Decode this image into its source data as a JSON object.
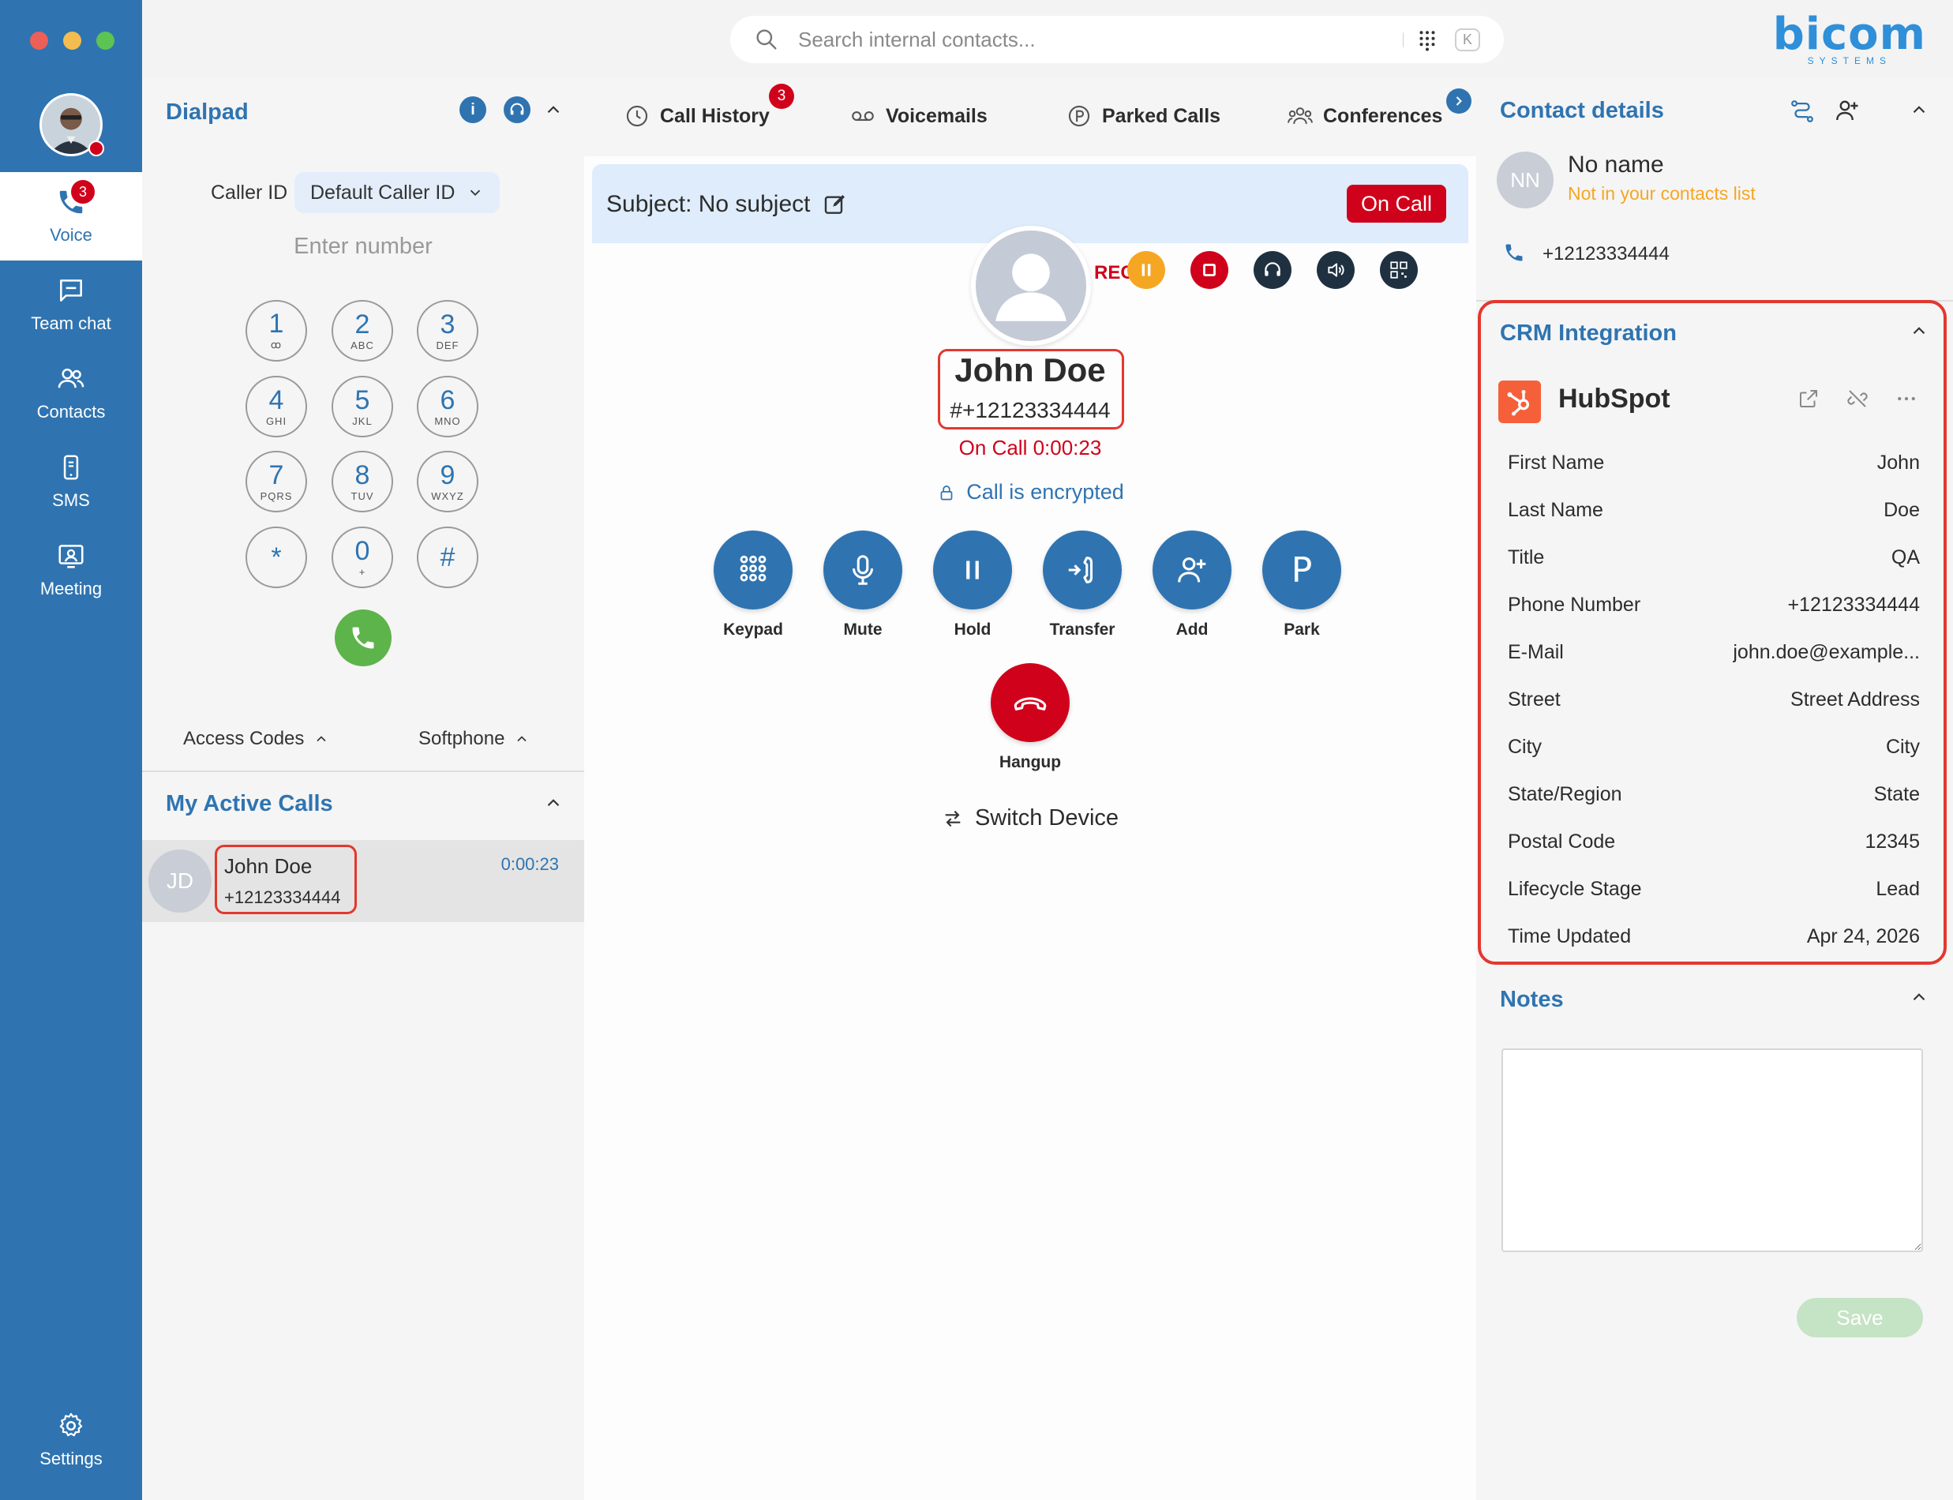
{
  "nav": {
    "items": [
      {
        "label": "Voice",
        "badge": "3"
      },
      {
        "label": "Team chat"
      },
      {
        "label": "Contacts"
      },
      {
        "label": "SMS"
      },
      {
        "label": "Meeting"
      }
    ],
    "settings_label": "Settings"
  },
  "topbar": {
    "search_placeholder": "Search internal contacts...",
    "shortcut_key1": "⌘",
    "shortcut_plus": "+",
    "shortcut_key2": "K",
    "logo_text": "bicom",
    "logo_sub": "SYSTEMS"
  },
  "dialpad": {
    "title": "Dialpad",
    "info_glyph": "i",
    "caller_id_label": "Caller ID",
    "caller_id_value": "Default Caller ID",
    "enter_number_placeholder": "Enter number",
    "keys": [
      {
        "digit": "1",
        "letters": "ꝏ"
      },
      {
        "digit": "2",
        "letters": "ABC"
      },
      {
        "digit": "3",
        "letters": "DEF"
      },
      {
        "digit": "4",
        "letters": "GHI"
      },
      {
        "digit": "5",
        "letters": "JKL"
      },
      {
        "digit": "6",
        "letters": "MNO"
      },
      {
        "digit": "7",
        "letters": "PQRS"
      },
      {
        "digit": "8",
        "letters": "TUV"
      },
      {
        "digit": "9",
        "letters": "WXYZ"
      },
      {
        "digit": "*",
        "letters": ""
      },
      {
        "digit": "0",
        "letters": "+"
      },
      {
        "digit": "#",
        "letters": ""
      }
    ],
    "access_codes_label": "Access Codes",
    "softphone_label": "Softphone"
  },
  "active_calls": {
    "title": "My Active Calls",
    "calls": [
      {
        "initials": "JD",
        "name": "John Doe",
        "number": "+12123334444",
        "duration": "0:00:23"
      }
    ]
  },
  "tabs": [
    {
      "label": "Call History",
      "badge": "3"
    },
    {
      "label": "Voicemails"
    },
    {
      "label": "Parked Calls"
    },
    {
      "label": "Conferences"
    }
  ],
  "call": {
    "subject": "Subject: No subject",
    "status_pill": "On Call",
    "rec_label": "REC",
    "caller_name": "John Doe",
    "caller_number": "#+12123334444",
    "status_time": "On Call 0:00:23",
    "encrypted_label": "Call is encrypted",
    "actions": [
      {
        "label": "Keypad"
      },
      {
        "label": "Mute"
      },
      {
        "label": "Hold"
      },
      {
        "label": "Transfer"
      },
      {
        "label": "Add"
      },
      {
        "label": "Park",
        "glyph": "P"
      }
    ],
    "hangup_label": "Hangup",
    "switch_device_label": "Switch Device"
  },
  "contact": {
    "title": "Contact details",
    "initials": "NN",
    "name": "No name",
    "subtitle": "Not in your contacts list",
    "phone": "+12123334444"
  },
  "crm": {
    "title": "CRM Integration",
    "provider": "HubSpot",
    "fields": [
      {
        "label": "First Name",
        "value": "John"
      },
      {
        "label": "Last Name",
        "value": "Doe"
      },
      {
        "label": "Title",
        "value": "QA"
      },
      {
        "label": "Phone Number",
        "value": "+12123334444"
      },
      {
        "label": "E-Mail",
        "value": "john.doe@example..."
      },
      {
        "label": "Street",
        "value": "Street Address"
      },
      {
        "label": "City",
        "value": "City"
      },
      {
        "label": "State/Region",
        "value": "State"
      },
      {
        "label": "Postal Code",
        "value": "12345"
      },
      {
        "label": "Lifecycle Stage",
        "value": "Lead"
      },
      {
        "label": "Time Updated",
        "value": "Apr 24, 2026"
      }
    ]
  },
  "notes": {
    "title": "Notes",
    "value": "",
    "save_label": "Save"
  },
  "colors": {
    "brand_blue": "#2f74b1",
    "danger_red": "#d0021b",
    "call_green": "#5db44b",
    "hubspot_orange": "#f5603a",
    "highlight_red": "#e2382f"
  }
}
